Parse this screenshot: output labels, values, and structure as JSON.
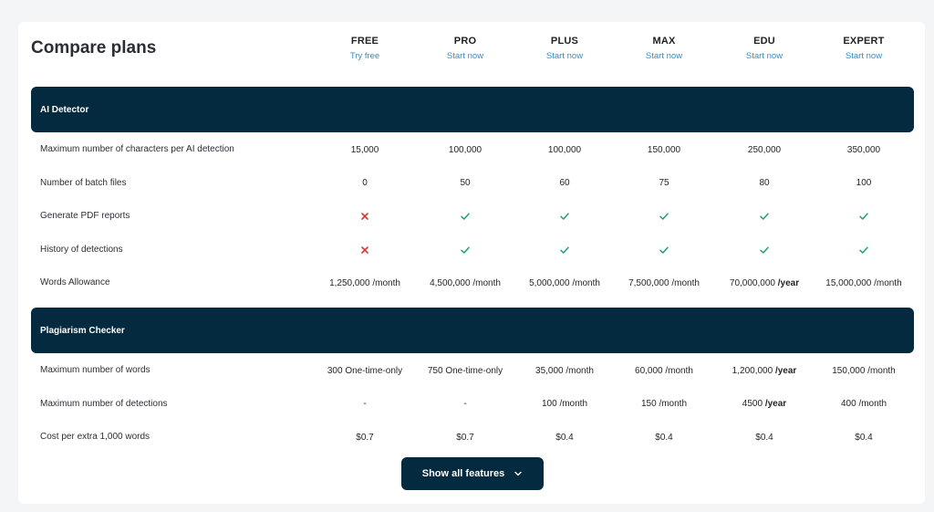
{
  "title": "Compare plans",
  "plans": [
    {
      "name": "FREE",
      "link": "Try free"
    },
    {
      "name": "PRO",
      "link": "Start now"
    },
    {
      "name": "PLUS",
      "link": "Start now"
    },
    {
      "name": "MAX",
      "link": "Start now"
    },
    {
      "name": "EDU",
      "link": "Start now"
    },
    {
      "name": "EXPERT",
      "link": "Start now"
    }
  ],
  "sections": [
    {
      "title": "AI Detector",
      "rows": [
        {
          "label": "Maximum number of characters per AI detection",
          "cells": [
            {
              "text": "15,000"
            },
            {
              "text": "100,000"
            },
            {
              "text": "100,000"
            },
            {
              "text": "150,000"
            },
            {
              "text": "250,000"
            },
            {
              "text": "350,000"
            }
          ]
        },
        {
          "label": "Number of batch files",
          "cells": [
            {
              "text": "0"
            },
            {
              "text": "50"
            },
            {
              "text": "60"
            },
            {
              "text": "75"
            },
            {
              "text": "80"
            },
            {
              "text": "100"
            }
          ]
        },
        {
          "label": "Generate PDF reports",
          "cells": [
            {
              "icon": "cross-icon"
            },
            {
              "icon": "check-icon"
            },
            {
              "icon": "check-icon"
            },
            {
              "icon": "check-icon"
            },
            {
              "icon": "check-icon"
            },
            {
              "icon": "check-icon"
            }
          ]
        },
        {
          "label": "History of detections",
          "cells": [
            {
              "icon": "cross-icon"
            },
            {
              "icon": "check-icon"
            },
            {
              "icon": "check-icon"
            },
            {
              "icon": "check-icon"
            },
            {
              "icon": "check-icon"
            },
            {
              "icon": "check-icon"
            }
          ]
        },
        {
          "label": "Words Allowance",
          "cells": [
            {
              "text": "1,250,000",
              "unit": "/month"
            },
            {
              "text": "4,500,000",
              "unit": "/month"
            },
            {
              "text": "5,000,000",
              "unit": "/month"
            },
            {
              "text": "7,500,000",
              "unit": "/month"
            },
            {
              "text": "70,000,000",
              "unit": "/year",
              "unit_bold": true
            },
            {
              "text": "15,000,000",
              "unit": "/month"
            }
          ]
        }
      ]
    },
    {
      "title": "Plagiarism Checker",
      "rows": [
        {
          "label": "Maximum number of words",
          "cells": [
            {
              "text": "300 One-time-only"
            },
            {
              "text": "750 One-time-only"
            },
            {
              "text": "35,000",
              "unit": "/month"
            },
            {
              "text": "60,000",
              "unit": "/month"
            },
            {
              "text": "1,200,000",
              "unit": "/year",
              "unit_bold": true
            },
            {
              "text": "150,000",
              "unit": "/month"
            }
          ]
        },
        {
          "label": "Maximum number of detections",
          "cells": [
            {
              "text": "-"
            },
            {
              "text": "-"
            },
            {
              "text": "100",
              "unit": "/month"
            },
            {
              "text": "150",
              "unit": "/month"
            },
            {
              "text": "4500",
              "unit": "/year",
              "unit_bold": true
            },
            {
              "text": "400",
              "unit": "/month"
            }
          ]
        },
        {
          "label": "Cost per extra 1,000 words",
          "cells": [
            {
              "text": "$0.7"
            },
            {
              "text": "$0.7"
            },
            {
              "text": "$0.4"
            },
            {
              "text": "$0.4"
            },
            {
              "text": "$0.4"
            },
            {
              "text": "$0.4"
            }
          ]
        }
      ]
    }
  ],
  "show_all_label": "Show all features",
  "show_all_icon": "chevron-down-icon",
  "colors": {
    "header_bar": "#032a3e",
    "link": "#2d8fd0",
    "check": "#1f9e7a",
    "cross": "#d93a3a"
  }
}
